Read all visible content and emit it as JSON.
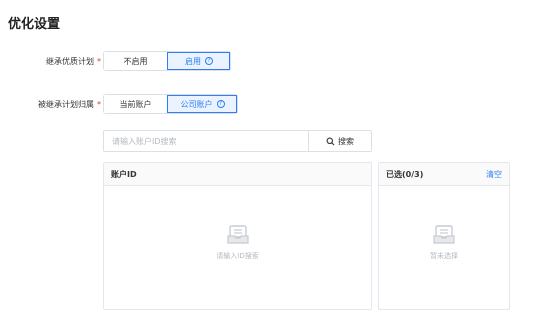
{
  "page_title": "优化设置",
  "inherit_plan": {
    "label": "继承优质计划",
    "required_mark": "*",
    "options": [
      "不启用",
      "启用"
    ],
    "selected": "启用"
  },
  "plan_owner": {
    "label": "被继承计划归属",
    "required_mark": "*",
    "options": [
      "当前账户",
      "公司账户"
    ],
    "selected": "公司账户"
  },
  "search": {
    "placeholder": "请输入账户ID搜索",
    "button_label": "搜索"
  },
  "left_panel": {
    "header": "账户ID",
    "empty_text": "请输入ID搜索"
  },
  "right_panel": {
    "header": "已选(0/3)",
    "clear_label": "清空",
    "empty_text": "暂未选择"
  },
  "colors": {
    "accent": "#2d7df6",
    "required": "#e53935",
    "border": "#dcdfe6"
  }
}
